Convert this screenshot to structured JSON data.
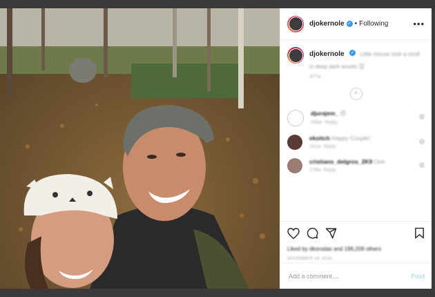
{
  "post": {
    "username": "djokernole",
    "separator": "•",
    "follow_status": "Following",
    "more_icon": "more-horizontal-icon",
    "caption": "Little mouse took a stroll in deep dark woods 🐭",
    "caption_time": "377w",
    "comments": [
      {
        "user": "djurajem_",
        "text": "😍",
        "time": "160w",
        "reply": "Reply"
      },
      {
        "user": "ekoitch",
        "text": "Happy Couple!",
        "time": "161w",
        "reply": "Reply"
      },
      {
        "user": "cristiano_delgros_2K9",
        "text": "Ooh",
        "time": "178w",
        "reply": "Reply"
      }
    ],
    "likes_text": "Liked by dkorodas and 196,209 others",
    "date": "NOVEMBER 18, 2018",
    "add_comment_placeholder": "Add a comment…",
    "post_label": "Post"
  },
  "colors": {
    "accent": "#3897f0",
    "post_disabled": "#b3dbff",
    "overlay": "#3a3a3a"
  }
}
